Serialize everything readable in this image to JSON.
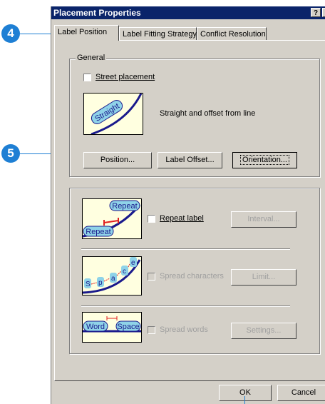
{
  "window": {
    "title": "Placement Properties",
    "help_glyph": "?",
    "close_glyph": "×"
  },
  "tabs": [
    {
      "label": "Label Position",
      "active": true
    },
    {
      "label": "Label Fitting Strategy",
      "active": false
    },
    {
      "label": "Conflict Resolution",
      "active": false
    }
  ],
  "general": {
    "group_label": "General",
    "street_placement": {
      "label": "Street placement",
      "checked": false
    },
    "preview_text": "Straight",
    "description": "Straight and offset from line",
    "buttons": {
      "position": "Position...",
      "label_offset": "Label Offset...",
      "orientation": "Orientation..."
    }
  },
  "options": {
    "repeat": {
      "label": "Repeat label",
      "checked": false,
      "enabled": true,
      "button": "Interval...",
      "button_enabled": false,
      "thumb_top": "Repeat",
      "thumb_bottom": "Repeat"
    },
    "spread_chars": {
      "label": "Spread characters",
      "checked": false,
      "enabled": false,
      "button": "Limit...",
      "button_enabled": false,
      "thumb_chars": [
        "S",
        "p",
        "a",
        "c",
        "e"
      ]
    },
    "spread_words": {
      "label": "Spread words",
      "checked": false,
      "enabled": false,
      "button": "Settings...",
      "button_enabled": false,
      "thumb_word1": "Word",
      "thumb_word2": "Space"
    }
  },
  "footer": {
    "ok": "OK",
    "cancel": "Cancel"
  },
  "callouts": {
    "four": "4",
    "five": "5"
  },
  "colors": {
    "callout": "#1e7fd4",
    "titlebar": "#0a246a",
    "dialog_bg": "#d4d0c8",
    "thumb_bg": "#ffffe0",
    "label_fill": "#8fd3e8",
    "line": "#1a1a8c",
    "offset_marker": "#e02020"
  }
}
